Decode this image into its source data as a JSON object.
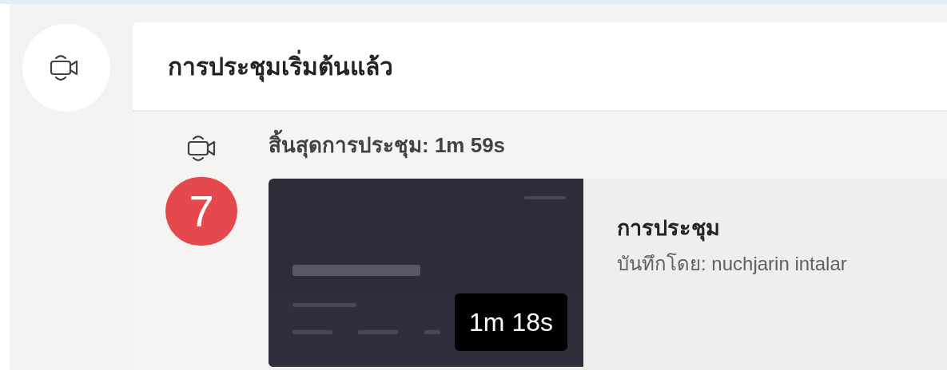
{
  "header": {
    "title": "การประชุมเริ่มต้นแล้ว"
  },
  "meeting_ended": {
    "text": "สิ้นสุดการประชุม: 1m 59s",
    "step_badge": "7"
  },
  "recording": {
    "duration": "1m 18s",
    "title": "การประชุม",
    "recorded_by": "บันทึกโดย: nuchjarin intalar"
  }
}
